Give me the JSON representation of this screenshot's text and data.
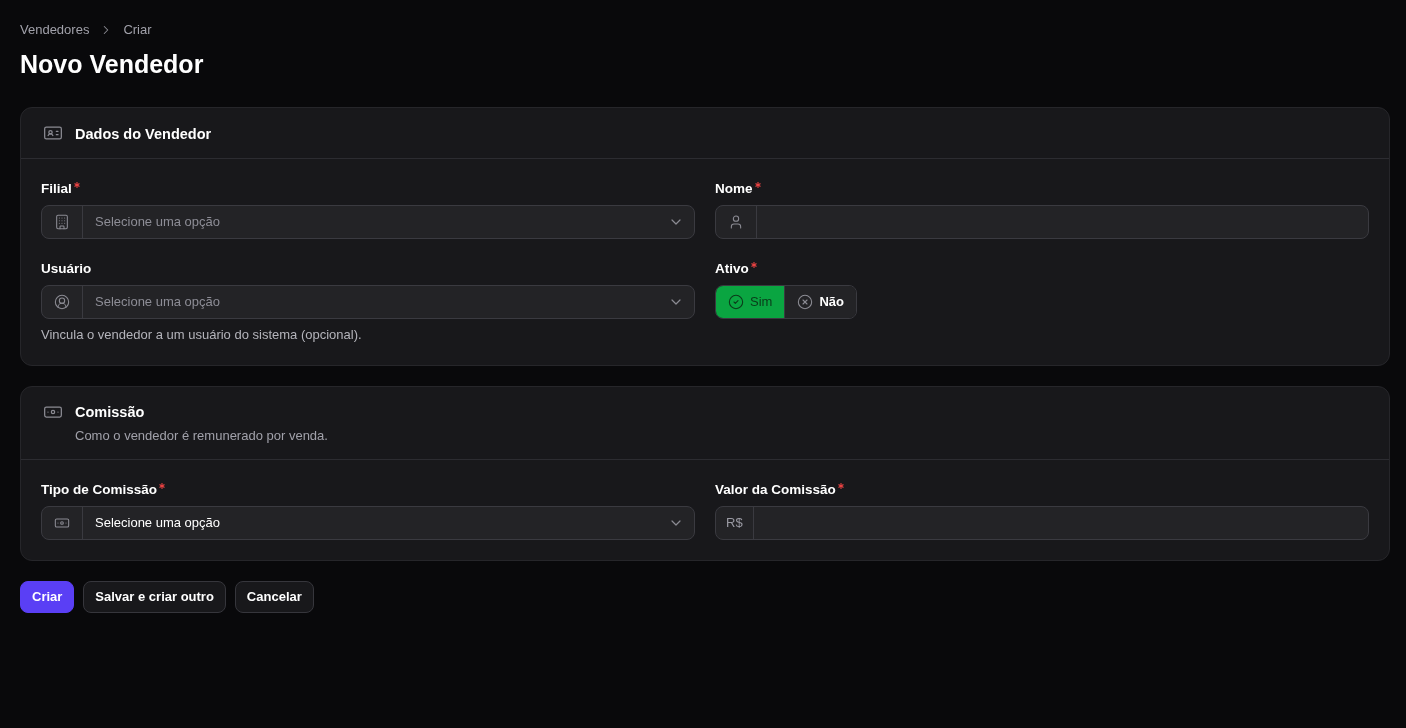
{
  "breadcrumbs": [
    {
      "label": "Vendedores"
    },
    {
      "label": "Criar"
    }
  ],
  "title": "Novo Vendedor",
  "sections": [
    {
      "heading": "Dados do Vendedor",
      "fields": [
        {
          "kind": "select",
          "label": "Filial",
          "required": true,
          "placeholder": "Selecione uma opção"
        },
        {
          "kind": "text",
          "label": "Nome",
          "required": true
        },
        {
          "kind": "select",
          "label": "Usuário",
          "required": false,
          "placeholder": "Selecione uma opção",
          "help": "Vincula o vendedor a um usuário do sistema (opcional)."
        },
        {
          "kind": "toggle",
          "label": "Ativo",
          "required": true,
          "options": [
            {
              "label": "Sim",
              "selected": true
            },
            {
              "label": "Não",
              "selected": false
            }
          ]
        }
      ]
    },
    {
      "heading": "Comissão",
      "description": "Como o vendedor é remunerado por venda.",
      "fields": [
        {
          "kind": "select",
          "label": "Tipo de Comissão",
          "required": true,
          "value": "Selecione uma opção"
        },
        {
          "kind": "money",
          "label": "Valor da Comissão",
          "required": true,
          "prefix": "R$"
        }
      ]
    }
  ],
  "buttons": [
    {
      "label": "Criar",
      "kind": "primary"
    },
    {
      "label": "Salvar e criar outro",
      "kind": "secondary"
    },
    {
      "label": "Cancelar",
      "kind": "secondary"
    }
  ]
}
